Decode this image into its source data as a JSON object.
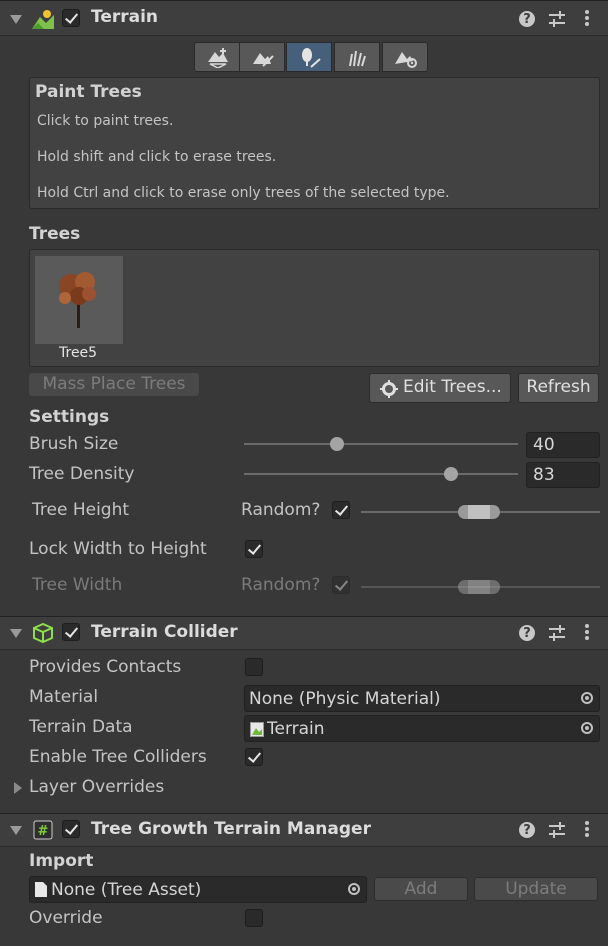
{
  "terrain": {
    "title": "Terrain",
    "enabled": true,
    "icons": {
      "help": "help-icon",
      "presets": "presets-icon",
      "menu": "more-menu-icon"
    },
    "toolbar": [
      "raise-lower-terrain-tool",
      "paint-texture-tool",
      "paint-trees-tool",
      "paint-details-tool",
      "terrain-settings-tool"
    ],
    "selected_tool_index": 2,
    "help_box": {
      "title": "Paint Trees",
      "lines": [
        "Click to paint trees.",
        "Hold shift and click to erase trees.",
        "Hold Ctrl and click to erase only trees of the selected type."
      ]
    },
    "trees_heading": "Trees",
    "trees": [
      {
        "name": "Tree5"
      }
    ],
    "buttons": {
      "mass_place": "Mass Place Trees",
      "edit_trees": "Edit Trees...",
      "refresh": "Refresh"
    },
    "settings_heading": "Settings",
    "brush_size": {
      "label": "Brush Size",
      "value": "40",
      "fraction": 0.33
    },
    "tree_density": {
      "label": "Tree Density",
      "value": "83",
      "fraction": 0.77
    },
    "tree_height": {
      "label": "Tree Height",
      "random_label": "Random?",
      "random": true
    },
    "lock_width": {
      "label": "Lock Width to Height",
      "checked": true
    },
    "tree_width": {
      "label": "Tree Width",
      "random_label": "Random?",
      "random": true
    }
  },
  "collider": {
    "title": "Terrain Collider",
    "enabled": true,
    "provides_contacts": {
      "label": "Provides Contacts",
      "checked": false
    },
    "material": {
      "label": "Material",
      "value": "None (Physic Material)"
    },
    "terrain_data": {
      "label": "Terrain Data",
      "value": "Terrain"
    },
    "enable_tree_colliders": {
      "label": "Enable Tree Colliders",
      "checked": true
    },
    "layer_overrides": {
      "label": "Layer Overrides"
    }
  },
  "manager": {
    "title": "Tree Growth Terrain Manager",
    "enabled": true,
    "import_heading": "Import",
    "import_value": "None (Tree Asset)",
    "add_label": "Add",
    "update_label": "Update",
    "override": {
      "label": "Override",
      "checked": false
    }
  },
  "colors": {
    "panel": "#383838",
    "header": "#3e3e3e",
    "selected_tool": "#46607c",
    "field": "#2a2a2a"
  }
}
